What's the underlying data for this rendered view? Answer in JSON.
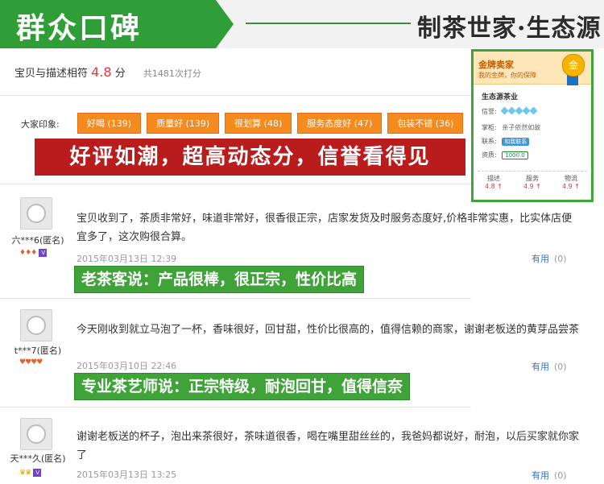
{
  "header": {
    "title": "群众口碑",
    "brand": "制茶世家·生态源"
  },
  "rating": {
    "label": "宝贝与描述相符",
    "score": "4.8",
    "unit": "分",
    "count": "共1481次打分"
  },
  "impressions": {
    "label": "大家印象:",
    "tags": [
      "好喝 (139)",
      "质量好 (139)",
      "很划算 (48)",
      "服务态度好 (47)",
      "包装不错 (36)"
    ]
  },
  "banner_red": "好评如潮，超高动态分，信誉看得见",
  "seller": {
    "title": "金牌卖家",
    "subtitle": "我的金牌，你的保障",
    "medal": "金",
    "shop": "生态源茶业",
    "credit_label": "信誉:",
    "keeper_label": "掌柜:",
    "keeper": "亲子依然如故",
    "contact_label": "联系:",
    "contact": "和我联系",
    "qual_label": "资质:",
    "deposit": "1000.0",
    "stats": [
      {
        "label": "描述",
        "value": "4.8 ↑"
      },
      {
        "label": "服务",
        "value": "4.9 ↑"
      },
      {
        "label": "物流",
        "value": "4.9 ↑"
      }
    ]
  },
  "reviews": [
    {
      "user": "六***6(匿名)",
      "text": "宝贝收到了，茶质非常好，味道非常好，很香很正宗，店家发货及时服务态度好,价格非常实惠，比实体店便宜多了，这次购很合算。",
      "date": "2015年03月13日 12:39",
      "useful": "有用",
      "useful_count": "(0)",
      "highlight": "老茶客说：产品很棒，很正宗，性价比高"
    },
    {
      "user": "t***7(匿名)",
      "text": "今天刚收到就立马泡了一杯，香味很好，回甘甜，性价比很高的，值得信赖的商家，谢谢老板送的黄芽品尝茶",
      "date": "2015年03月10日 22:46",
      "useful": "有用",
      "useful_count": "(0)",
      "highlight": "专业茶艺师说：正宗特级，耐泡回甘，值得信奈"
    },
    {
      "user": "天***久(匿名)",
      "text": "谢谢老板送的杯子，泡出来茶很好，茶味道很香，喝在嘴里甜丝丝的，我爸妈都说好，耐泡，以后买家就你家了",
      "date": "2015年03月13日 13:25",
      "useful": "有用",
      "useful_count": "(0)"
    }
  ]
}
